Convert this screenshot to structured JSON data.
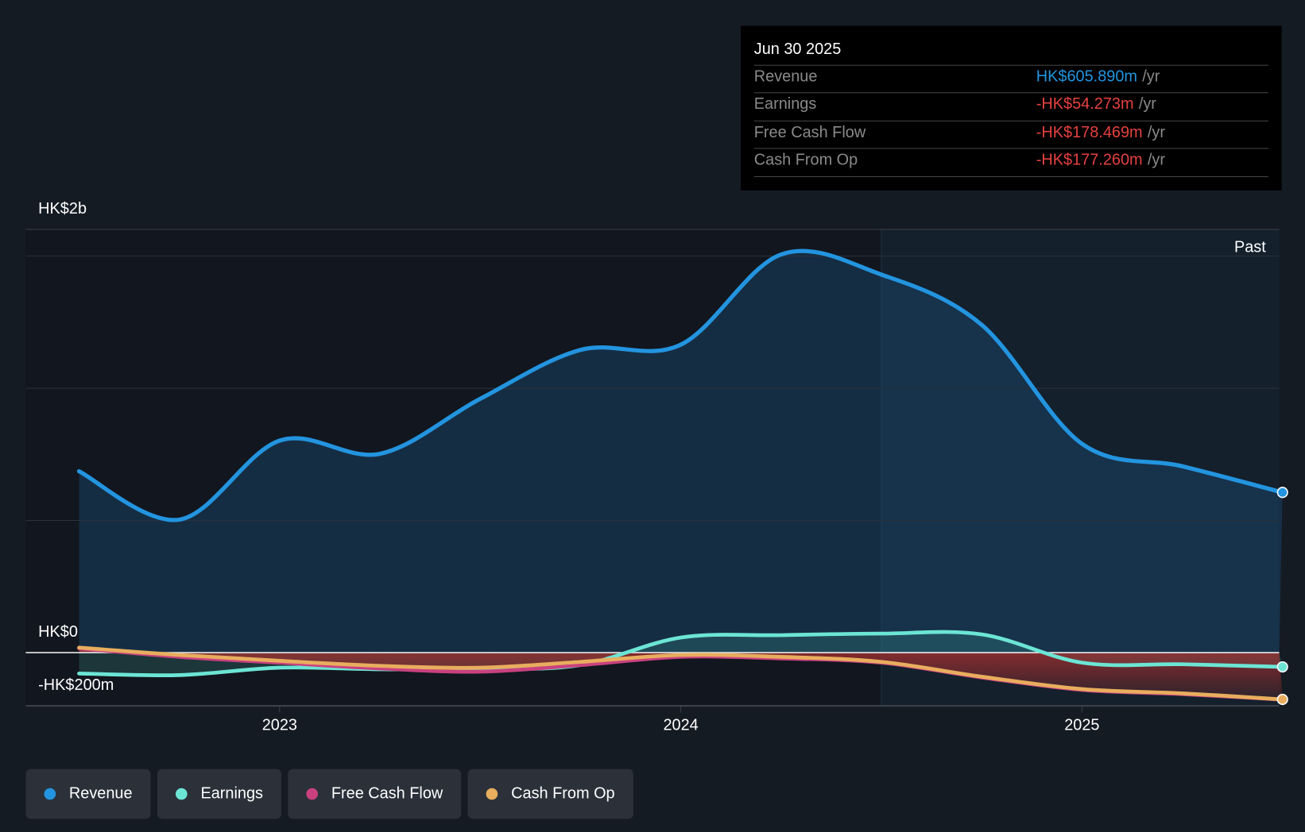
{
  "tooltip": {
    "date": "Jun 30 2025",
    "rows": [
      {
        "label": "Revenue",
        "value": "HK$605.890m",
        "unit": "/yr",
        "color": "#2394df"
      },
      {
        "label": "Earnings",
        "value": "-HK$54.273m",
        "unit": "/yr",
        "color": "#e64141"
      },
      {
        "label": "Free Cash Flow",
        "value": "-HK$178.469m",
        "unit": "/yr",
        "color": "#e64141"
      },
      {
        "label": "Cash From Op",
        "value": "-HK$177.260m",
        "unit": "/yr",
        "color": "#e64141"
      }
    ]
  },
  "chart_data": {
    "type": "line",
    "title": "",
    "y_tick_labels": [
      "HK$2b",
      "HK$0",
      "-HK$200m"
    ],
    "x_tick_labels": [
      "2023",
      "2024",
      "2025"
    ],
    "x": [
      2022.5,
      2022.75,
      2023.0,
      2023.25,
      2023.5,
      2023.75,
      2024.0,
      2024.25,
      2024.5,
      2024.75,
      2025.0,
      2025.25,
      2025.5
    ],
    "ylim": [
      -200,
      1600
    ],
    "unit": "HK$m",
    "past_from": 2024.5,
    "past_label": "Past",
    "series": [
      {
        "name": "Revenue",
        "color": "#2394df",
        "values": [
          686,
          503,
          802,
          752,
          960,
          1145,
          1165,
          1506,
          1430,
          1240,
          790,
          705,
          606
        ]
      },
      {
        "name": "Earnings",
        "color": "#6ce5d4",
        "values": [
          -79,
          -85,
          -57,
          -63,
          -63,
          -47,
          57,
          66,
          72,
          69,
          -38,
          -44,
          -54
        ]
      },
      {
        "name": "Free Cash Flow",
        "color": "#c9417f",
        "values": [
          16,
          -16,
          -38,
          -60,
          -72,
          -47,
          -16,
          -22,
          -38,
          -94,
          -141,
          -157,
          -178
        ]
      },
      {
        "name": "Cash From Op",
        "color": "#e8ad5e",
        "values": [
          19,
          -9,
          -31,
          -50,
          -57,
          -35,
          -9,
          -16,
          -35,
          -91,
          -138,
          -154,
          -177
        ]
      }
    ]
  }
}
